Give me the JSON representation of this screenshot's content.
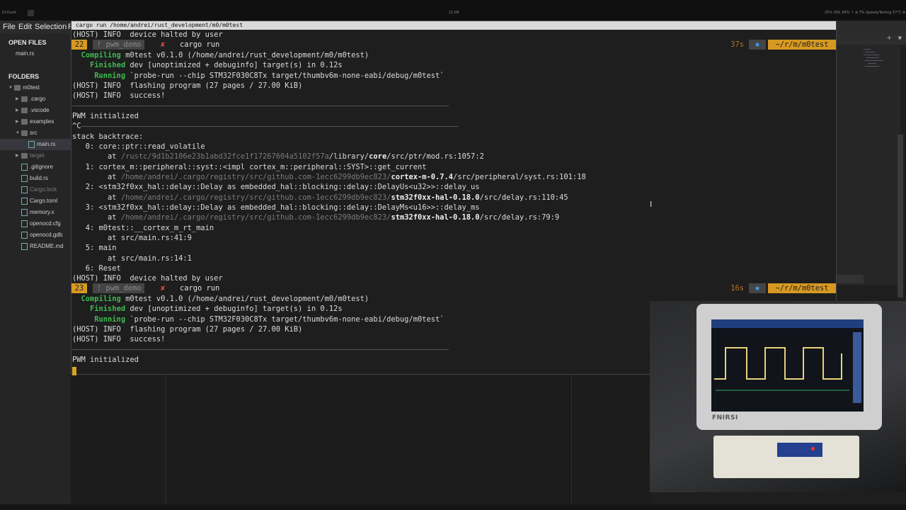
{
  "topbar": {
    "left": "Dr.Dunk",
    "clock": "11:08",
    "status": "25%  VOL 99% ↑  ⊕  7%  SpeedyTesting  57°C  ⊕"
  },
  "menubar": {
    "file": "File",
    "edit": "Edit",
    "selection": "Selection",
    "trunc": "F"
  },
  "sidebar": {
    "open_files_header": "OPEN FILES",
    "open_file": "main.rs",
    "folders_header": "FOLDERS",
    "tree": [
      {
        "label": "m0test",
        "kind": "folder",
        "expanded": true
      },
      {
        "label": ".cargo",
        "kind": "folder"
      },
      {
        "label": ".vscode",
        "kind": "folder"
      },
      {
        "label": "examples",
        "kind": "folder"
      },
      {
        "label": "src",
        "kind": "folder",
        "expanded": true
      },
      {
        "label": "main.rs",
        "kind": "file",
        "selected": true
      },
      {
        "label": "target",
        "kind": "folder",
        "dim": true
      },
      {
        "label": ".gitignore",
        "kind": "file"
      },
      {
        "label": "build.rs",
        "kind": "file"
      },
      {
        "label": "Cargo.lock",
        "kind": "file",
        "dim": true
      },
      {
        "label": "Cargo.toml",
        "kind": "file"
      },
      {
        "label": "memory.x",
        "kind": "file"
      },
      {
        "label": "openocd.cfg",
        "kind": "file"
      },
      {
        "label": "openocd.gdb",
        "kind": "file"
      },
      {
        "label": "README.md",
        "kind": "file"
      }
    ]
  },
  "terminal": {
    "title": "cargo run /home/andrei/rust_development/m0/m0test",
    "line_01": "(HOST) INFO  device halted by user",
    "prompt1": {
      "num": "22",
      "branch": "ᚠ pwm_demo",
      "x": "✘",
      "cmd": "cargo run",
      "dur": "37s",
      "star": "✱",
      "path": "~/r/m/m0test"
    },
    "compiling_kw": "Compiling",
    "compiling_rest": " m0test v0.1.0 (/home/andrei/rust_development/m0/m0test)",
    "finished_kw": "Finished",
    "finished_rest": " dev [unoptimized + debuginfo] target(s) in 0.12s",
    "running_kw": "Running",
    "running_rest": " `probe-run --chip STM32F030C8Tx target/thumbv6m-none-eabi/debug/m0test`",
    "flashing": "(HOST) INFO  flashing program (27 pages / 27.00 KiB)",
    "success": "(HOST) INFO  success!",
    "pwm": "PWM initialized",
    "ctrl_c": "^C",
    "backtrace_hdr": "stack backtrace:",
    "bt0": "   0: core::ptr::read_volatile",
    "bt0_at_pre": "        at ",
    "bt0_at_dim": "/rustc/9d1b2106e23b1abd32fce1f17267604a5102f57a",
    "bt0_at_mid": "/library/",
    "bt0_at_bold": "core",
    "bt0_at_post": "/src/ptr/mod.rs:1057:2",
    "bt1": "   1: cortex_m::peripheral::syst::<impl cortex_m::peripheral::SYST>::get_current",
    "bt1_at_pre": "        at ",
    "bt1_at_dim": "/home/andrei/.cargo/registry/src/github.com-1ecc6299db9ec823/",
    "bt1_at_bold": "cortex-m-0.7.4",
    "bt1_at_post": "/src/peripheral/syst.rs:101:18",
    "bt2": "   2: <stm32f0xx_hal::delay::Delay as embedded_hal::blocking::delay::DelayUs<u32>>::delay_us",
    "bt2_at_pre": "        at ",
    "bt2_at_dim": "/home/andrei/.cargo/registry/src/github.com-1ecc6299db9ec823/",
    "bt2_at_bold": "stm32f0xx-hal-0.18.0",
    "bt2_at_post": "/src/delay.rs:110:45",
    "bt3": "   3: <stm32f0xx_hal::delay::Delay as embedded_hal::blocking::delay::DelayMs<u16>>::delay_ms",
    "bt3_at_pre": "        at ",
    "bt3_at_dim": "/home/andrei/.cargo/registry/src/github.com-1ecc6299db9ec823/",
    "bt3_at_bold": "stm32f0xx-hal-0.18.0",
    "bt3_at_post": "/src/delay.rs:79:9",
    "bt4": "   4: m0test::__cortex_m_rt_main",
    "bt4_at": "        at src/main.rs:41:9",
    "bt5": "   5: main",
    "bt5_at": "        at src/main.rs:14:1",
    "bt6": "   6: Reset",
    "line_halt2": "(HOST) INFO  device halted by user",
    "prompt2": {
      "num": "23",
      "branch": "ᚠ pwm_demo",
      "x": "✘",
      "cmd": "cargo run",
      "dur": "16s",
      "star": "✱",
      "path": "~/r/m/m0test"
    }
  },
  "scope": {
    "brand": "FNIRSI"
  },
  "colors": {
    "accent": "#d79921",
    "green": "#3fb950",
    "error": "#e74c3c",
    "cursor": "#d4a61b",
    "wave": "#e8d27a"
  }
}
